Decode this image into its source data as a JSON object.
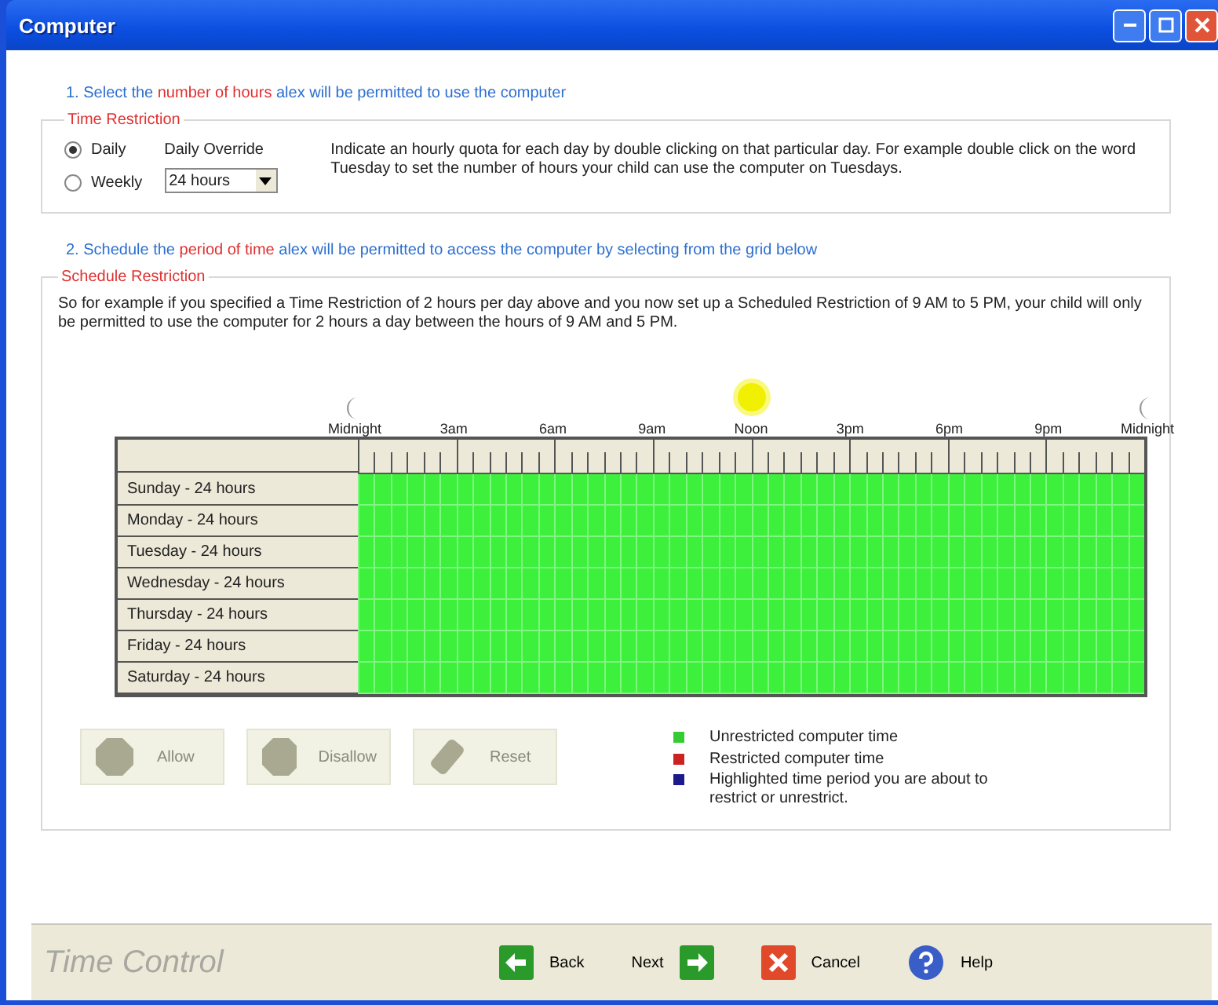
{
  "window": {
    "title": "Computer"
  },
  "step1": [
    {
      "text": "1. Select the ",
      "highlight": false
    },
    {
      "text": "number of hours",
      "highlight": true
    },
    {
      "text": " alex will be permitted to use the computer",
      "highlight": false
    }
  ],
  "time_restriction": {
    "title": "Time Restriction",
    "options": [
      {
        "label": "Daily",
        "selected": true
      },
      {
        "label": "Weekly",
        "selected": false
      }
    ],
    "override_label": "Daily Override",
    "override_value": "24 hours",
    "help": "Indicate an hourly quota for each day by double clicking on that particular day. For example double click on the word Tuesday to set the number of hours your child can use the computer on Tuesdays."
  },
  "step2": [
    {
      "text": "2. Schedule the ",
      "highlight": false
    },
    {
      "text": "period of time",
      "highlight": true
    },
    {
      "text": " alex will be permitted to access the computer by selecting from the grid below",
      "highlight": false
    }
  ],
  "schedule_restriction": {
    "title": "Schedule Restriction",
    "help": "So for example if you specified a Time Restriction of 2 hours per day above and you now set up a Scheduled Restriction of 9 AM to 5 PM, your child will only be permitted to use the computer for 2 hours a day between the hours of 9 AM and 5 PM.",
    "time_labels": [
      {
        "label": "Midnight",
        "kind": "night"
      },
      {
        "label": "3am",
        "kind": "plain"
      },
      {
        "label": "6am",
        "kind": "plain"
      },
      {
        "label": "9am",
        "kind": "plain"
      },
      {
        "label": "Noon",
        "kind": "day"
      },
      {
        "label": "3pm",
        "kind": "plain"
      },
      {
        "label": "6pm",
        "kind": "plain"
      },
      {
        "label": "9pm",
        "kind": "plain"
      },
      {
        "label": "Midnight",
        "kind": "night"
      }
    ],
    "days": [
      {
        "label": "Sunday - 24 hours",
        "restricted": false
      },
      {
        "label": "Monday - 24 hours",
        "restricted": false
      },
      {
        "label": "Tuesday - 24 hours",
        "restricted": false
      },
      {
        "label": "Wednesday - 24 hours",
        "restricted": false
      },
      {
        "label": "Thursday - 24 hours",
        "restricted": false
      },
      {
        "label": "Friday - 24 hours",
        "restricted": false
      },
      {
        "label": "Saturday - 24 hours",
        "restricted": false
      }
    ],
    "actions": [
      {
        "label": "Allow",
        "kind": "allow",
        "disabled": true
      },
      {
        "label": "Disallow",
        "kind": "disallow",
        "disabled": true
      },
      {
        "label": "Reset",
        "kind": "reset",
        "disabled": true
      }
    ],
    "legend": [
      {
        "label": "Unrestricted computer time",
        "color": "#33cc33"
      },
      {
        "label": "Restricted computer time",
        "color": "#cc2222"
      },
      {
        "label": "Highlighted time period you are about to restrict or unrestrict.",
        "color": "#1a1a8c"
      }
    ]
  },
  "footer": {
    "brand": "Time Control",
    "buttons": [
      {
        "label": "Back",
        "kind": "back"
      },
      {
        "label": "Next",
        "kind": "next"
      },
      {
        "label": "Cancel",
        "kind": "cancel"
      },
      {
        "label": "Help",
        "kind": "help"
      }
    ]
  }
}
